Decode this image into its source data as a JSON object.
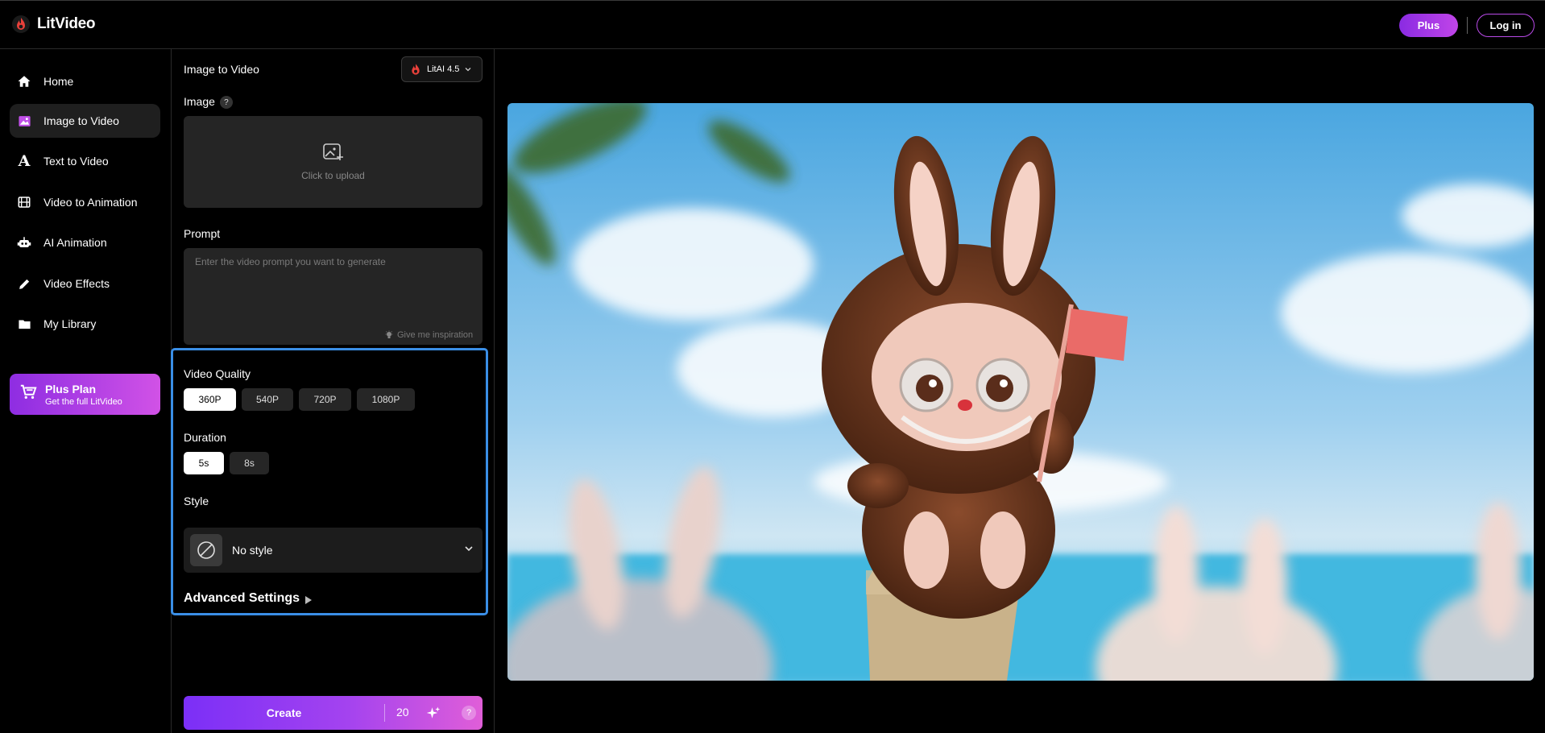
{
  "app": {
    "name": "LitVideo"
  },
  "header": {
    "plus_label": "Plus",
    "login_label": "Log in"
  },
  "sidebar": {
    "items": [
      {
        "label": "Home",
        "icon": "home-icon"
      },
      {
        "label": "Image to Video",
        "icon": "image-icon",
        "active": true
      },
      {
        "label": "Text to Video",
        "icon": "text-icon"
      },
      {
        "label": "Video to Animation",
        "icon": "film-icon"
      },
      {
        "label": "AI Animation",
        "icon": "robot-icon"
      },
      {
        "label": "Video Effects",
        "icon": "pencil-icon"
      },
      {
        "label": "My Library",
        "icon": "folder-icon"
      }
    ],
    "plus_plan": {
      "title": "Plus Plan",
      "subtitle": "Get the full LitVideo"
    }
  },
  "panel": {
    "title": "Image to Video",
    "model": "LitAI 4.5",
    "image_label": "Image",
    "help_glyph": "?",
    "upload_text": "Click to upload",
    "prompt_label": "Prompt",
    "prompt_placeholder": "Enter the video prompt you want to generate",
    "inspiration": "Give me inspiration",
    "quality_label": "Video Quality",
    "qualities": [
      "360P",
      "540P",
      "720P",
      "1080P"
    ],
    "selected_quality": "360P",
    "duration_label": "Duration",
    "durations": [
      "5s",
      "8s"
    ],
    "selected_duration": "5s",
    "style_label": "Style",
    "style_value": "No style",
    "advanced_label": "Advanced Settings",
    "create_label": "Create",
    "credits": "20"
  },
  "colors": {
    "accent": "#a443ef",
    "highlight": "#3a8ee6"
  }
}
